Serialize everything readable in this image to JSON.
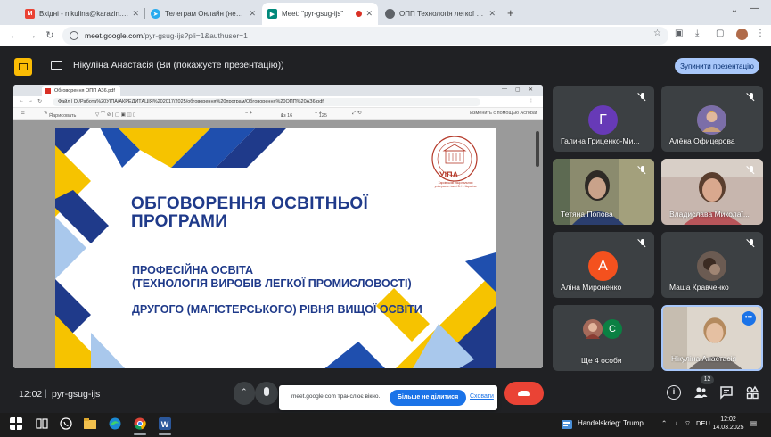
{
  "browser": {
    "tabs": [
      {
        "title": "Вхідні - nikulina@karazin.ua -",
        "favicon": "gmail-icon",
        "color": "#ea4335",
        "letter": "M"
      },
      {
        "title": "Телеграм Онлайн (неофіційні",
        "favicon": "telegram-icon",
        "color": "#2aabee",
        "letter": ""
      },
      {
        "title": "Meet: \"pyr-gsug-ijs\"",
        "favicon": "meet-icon",
        "color": "#00897b",
        "letter": ""
      },
      {
        "title": "ОПП Технологія легкої проми",
        "favicon": "globe-icon",
        "color": "#5f6368",
        "letter": ""
      }
    ],
    "address_host": "meet.google.com",
    "address_path": "/pyr-gsug-ijs?pli=1&authuser=1"
  },
  "meet": {
    "banner_text": "Нікуліна Анастасія (Ви (покажуєте презентацію))",
    "stop_presenting": "Зупинити презентацію",
    "clock": "12:02",
    "meeting_code": "pyr-gsug-ijs",
    "participant_count": "12",
    "share_popup": {
      "message": "meet.google.com транслює вікно.",
      "stop_button": "Більше не ділитися",
      "hide_link": "Сховати"
    }
  },
  "pdf_viewer": {
    "tab_title": "Обговорення ОПП АЗ6.pdf",
    "file_label": "Файл",
    "address": "D:/Работа%20УІПА/АКРЕДИТАЦІЯ%202017/2025/обговорення%20програм/Обговорення%20ОПП%20АЗ6.pdf",
    "toolbar_draw": "Нарисовать",
    "page_current": "1",
    "page_total": "из 16",
    "zoom": "125",
    "edit_acrobat": "Изменить с помощью Acrobat"
  },
  "slide": {
    "title_line1": "ОБГОВОРЕННЯ ОСВІТНЬОЇ",
    "title_line2": "ПРОГРАМИ",
    "subtitle_line1": "ПРОФЕСІЙНА ОСВІТА",
    "subtitle_line2": "(ТЕХНОЛОГІЯ ВИРОБІВ ЛЕГКОЇ ПРОМИСЛОВОСТІ)",
    "subtitle_line3": "ДРУГОГО (МАГІСТЕРСЬКОГО) РІВНЯ ВИЩОЇ ОСВІТИ",
    "logo_text": "УІПА",
    "logo_caption": "Харківський національний університет імені В. Н. Каразіна"
  },
  "participants": [
    {
      "name": "Галина Гриценко-Ми...",
      "initial": "Г",
      "color": "#673ab7"
    },
    {
      "name": "Алёна Офицерова",
      "initial": "",
      "color": "#8d6e63"
    },
    {
      "name": "Тетяна Попова",
      "initial": "",
      "color": "#6d6d5f"
    },
    {
      "name": "Владиславa Миколаї...",
      "initial": "",
      "color": "#9e8a80"
    },
    {
      "name": "Аліна Мироненко",
      "initial": "А",
      "color": "#f4511e"
    },
    {
      "name": "Маша Кравченко",
      "initial": "",
      "color": "#5d4e45"
    },
    {
      "name": "Ще 4 особи",
      "initial": "С",
      "color": "#0b8043"
    },
    {
      "name": "Нікуліна Анастасія",
      "initial": "",
      "color": "#b49a84"
    }
  ],
  "taskbar": {
    "news": "Handelskrieg: Trump...",
    "lang": "DEU",
    "time": "12:02",
    "date": "14.03.2025"
  }
}
